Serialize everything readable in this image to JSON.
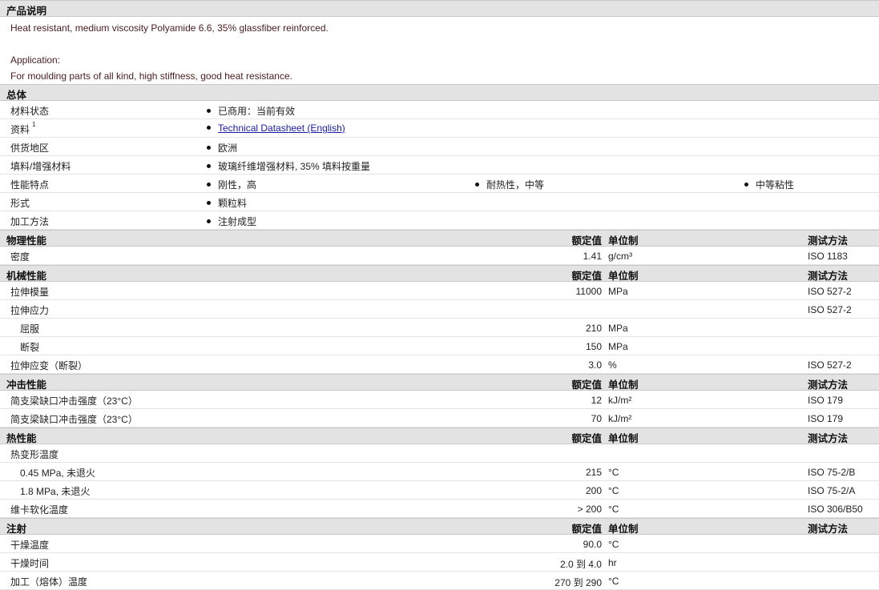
{
  "description": {
    "header": "产品说明",
    "line1": "Heat resistant, medium viscosity Polyamide 6.6, 35% glassfiber reinforced.",
    "line2": "Application:",
    "line3": "For moulding parts of all kind, high stiffness, good heat resistance."
  },
  "general": {
    "header": "总体",
    "rows": [
      {
        "label": "材料状态",
        "items": [
          "已商用：当前有效"
        ]
      },
      {
        "label": "资料",
        "sup": "1",
        "link": "Technical Datasheet (English)"
      },
      {
        "label": "供货地区",
        "items": [
          "欧洲"
        ]
      },
      {
        "label": "填料/增强材料",
        "items": [
          "玻璃纤维增强材料, 35% 填料按重量"
        ]
      },
      {
        "label": "性能特点",
        "items": [
          "刚性，高",
          "耐热性，中等",
          "中等粘性"
        ]
      },
      {
        "label": "形式",
        "items": [
          "颗粒料"
        ]
      },
      {
        "label": "加工方法",
        "items": [
          "注射成型"
        ]
      }
    ]
  },
  "columns": {
    "value": "额定值",
    "unit": "单位制",
    "method": "测试方法"
  },
  "physical": {
    "header": "物理性能",
    "rows": [
      {
        "label": "密度",
        "value": "1.41",
        "unit": "g/cm³",
        "method": "ISO 1183"
      }
    ]
  },
  "mechanical": {
    "header": "机械性能",
    "rows": [
      {
        "label": "拉伸模量",
        "value": "11000",
        "unit": "MPa",
        "method": "ISO 527-2"
      },
      {
        "label": "拉伸应力",
        "value": "",
        "unit": "",
        "method": "ISO 527-2"
      },
      {
        "label": "屈服",
        "value": "210",
        "unit": "MPa",
        "method": "",
        "indent": true
      },
      {
        "label": "断裂",
        "value": "150",
        "unit": "MPa",
        "method": "",
        "indent": true
      },
      {
        "label": "拉伸应变（断裂）",
        "value": "3.0",
        "unit": "%",
        "method": "ISO 527-2"
      }
    ]
  },
  "impact": {
    "header": "冲击性能",
    "rows": [
      {
        "label": "简支梁缺口冲击强度（23°C）",
        "value": "12",
        "unit": "kJ/m²",
        "method": "ISO 179"
      },
      {
        "label": "简支梁缺口冲击强度（23°C）",
        "value": "70",
        "unit": "kJ/m²",
        "method": "ISO 179"
      }
    ]
  },
  "thermal": {
    "header": "热性能",
    "rows": [
      {
        "label": "热变形温度",
        "value": "",
        "unit": "",
        "method": ""
      },
      {
        "label": "0.45 MPa, 未退火",
        "value": "215",
        "unit": "°C",
        "method": "ISO 75-2/B",
        "indent": true
      },
      {
        "label": "1.8 MPa, 未退火",
        "value": "200",
        "unit": "°C",
        "method": "ISO 75-2/A",
        "indent": true
      },
      {
        "label": "维卡软化温度",
        "value": "> 200",
        "unit": "°C",
        "method": "ISO 306/B50"
      }
    ]
  },
  "injection": {
    "header": "注射",
    "rows": [
      {
        "label": "干燥温度",
        "value": "90.0",
        "unit": "°C",
        "method": ""
      },
      {
        "label": "干燥时间",
        "value": "2.0 到  4.0",
        "unit": "hr",
        "method": ""
      },
      {
        "label": "加工（熔体）温度",
        "value": "270 到  290",
        "unit": "°C",
        "method": ""
      }
    ]
  }
}
